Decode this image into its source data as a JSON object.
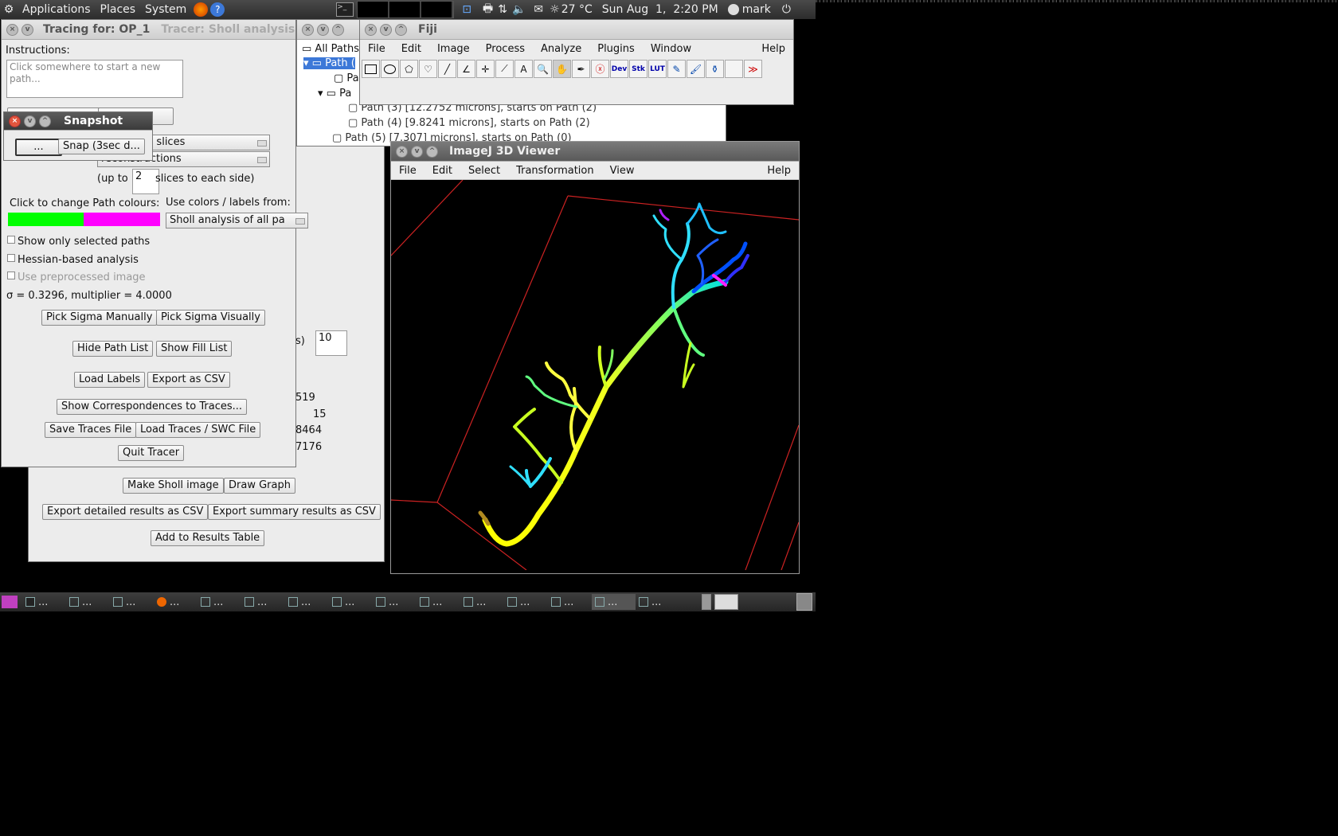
{
  "top_panel": {
    "menus": [
      "Applications",
      "Places",
      "System"
    ],
    "weather": "27 °C",
    "clock": "Sun Aug  1,  2:20 PM",
    "user": "mark"
  },
  "tracer": {
    "title": "Tracing for: OP_1",
    "background_tab": "Tracer: Sholl analysis",
    "instructions_label": "Instructions:",
    "instructions_text": "Click somewhere to start a new path...",
    "view_combo_1": "hrough all slices",
    "view_combo_2": "reconstructions",
    "upto_label": "(up to",
    "slices_value": "2",
    "slices_suffix": "slices to each side)",
    "path_colours_label": "Click to change Path colours:",
    "colors_from_label": "Use colors / labels from:",
    "colors_from_value": "Sholl analysis of all pa",
    "colour_left": "#00ff00",
    "colour_right": "#ff00ff",
    "show_selected": "Show only selected paths",
    "hessian": "Hessian-based analysis",
    "preprocessed": "Use preprocessed image",
    "sigma_text": "σ = 0.3296, multiplier = 4.0000",
    "pick_sigma_manually": "Pick Sigma Manually",
    "pick_sigma_visually": "Pick Sigma Visually",
    "hide_path_list": "Hide Path List",
    "show_fill_list": "Show Fill List",
    "load_labels": "Load Labels",
    "export_csv": "Export as CSV",
    "show_correspondences": "Show Correspondences to Traces...",
    "save_traces": "Save Traces File",
    "load_traces": "Load Traces / SWC File",
    "quit_tracer": "Quit Tracer"
  },
  "snapshot": {
    "title": "Snapshot",
    "dots_button": "...",
    "snap_button": "Snap (3sec d..."
  },
  "sholl": {
    "field_suffix": "s)",
    "field_value": "10",
    "value_1": "519",
    "value_2": "15",
    "value_3": "8464",
    "value_4": "7176",
    "make_sholl_image": "Make Sholl image",
    "draw_graph": "Draw Graph",
    "export_detailed": "Export detailed results as CSV",
    "export_summary": "Export summary results as CSV",
    "add_results": "Add to Results Table"
  },
  "path_tree": {
    "root": "All Paths",
    "items": [
      "Path (",
      "Pa",
      "Pa",
      "Path (3) [12.2752 microns], starts on Path (2)",
      "Path (4) [9.8241 microns], starts on Path (2)",
      "Path (5) [7.307] microns], starts on Path (0)"
    ]
  },
  "fiji": {
    "title": "Fiji",
    "menus": [
      "File",
      "Edit",
      "Image",
      "Process",
      "Analyze",
      "Plugins",
      "Window"
    ],
    "help": "Help",
    "tools": [
      "rectangle-tool-icon",
      "oval-tool-icon",
      "polygon-tool-icon",
      "freehand-tool-icon",
      "line-tool-icon",
      "angle-tool-icon",
      "point-tool-icon",
      "wand-tool-icon",
      "text-tool-icon",
      "zoom-tool-icon",
      "hand-tool-icon",
      "dropper-tool-icon",
      "close-tool-icon",
      "dev-tool-icon",
      "stk-tool-icon",
      "lut-tool-icon",
      "pencil-tool-icon",
      "brush-tool-icon",
      "flood-tool-icon",
      "blank-tool-icon",
      "more-tools-icon"
    ],
    "tool_labels": {
      "text": "A",
      "dev": "Dev",
      "stk": "Stk",
      "lut": "LUT",
      "more": "≫"
    }
  },
  "viewer": {
    "title": "ImageJ 3D Viewer",
    "menus": [
      "File",
      "Edit",
      "Select",
      "Transformation",
      "View"
    ],
    "help": "Help"
  },
  "colors": {
    "box_line": "#cc2222",
    "taskbar_active": "#555555"
  }
}
